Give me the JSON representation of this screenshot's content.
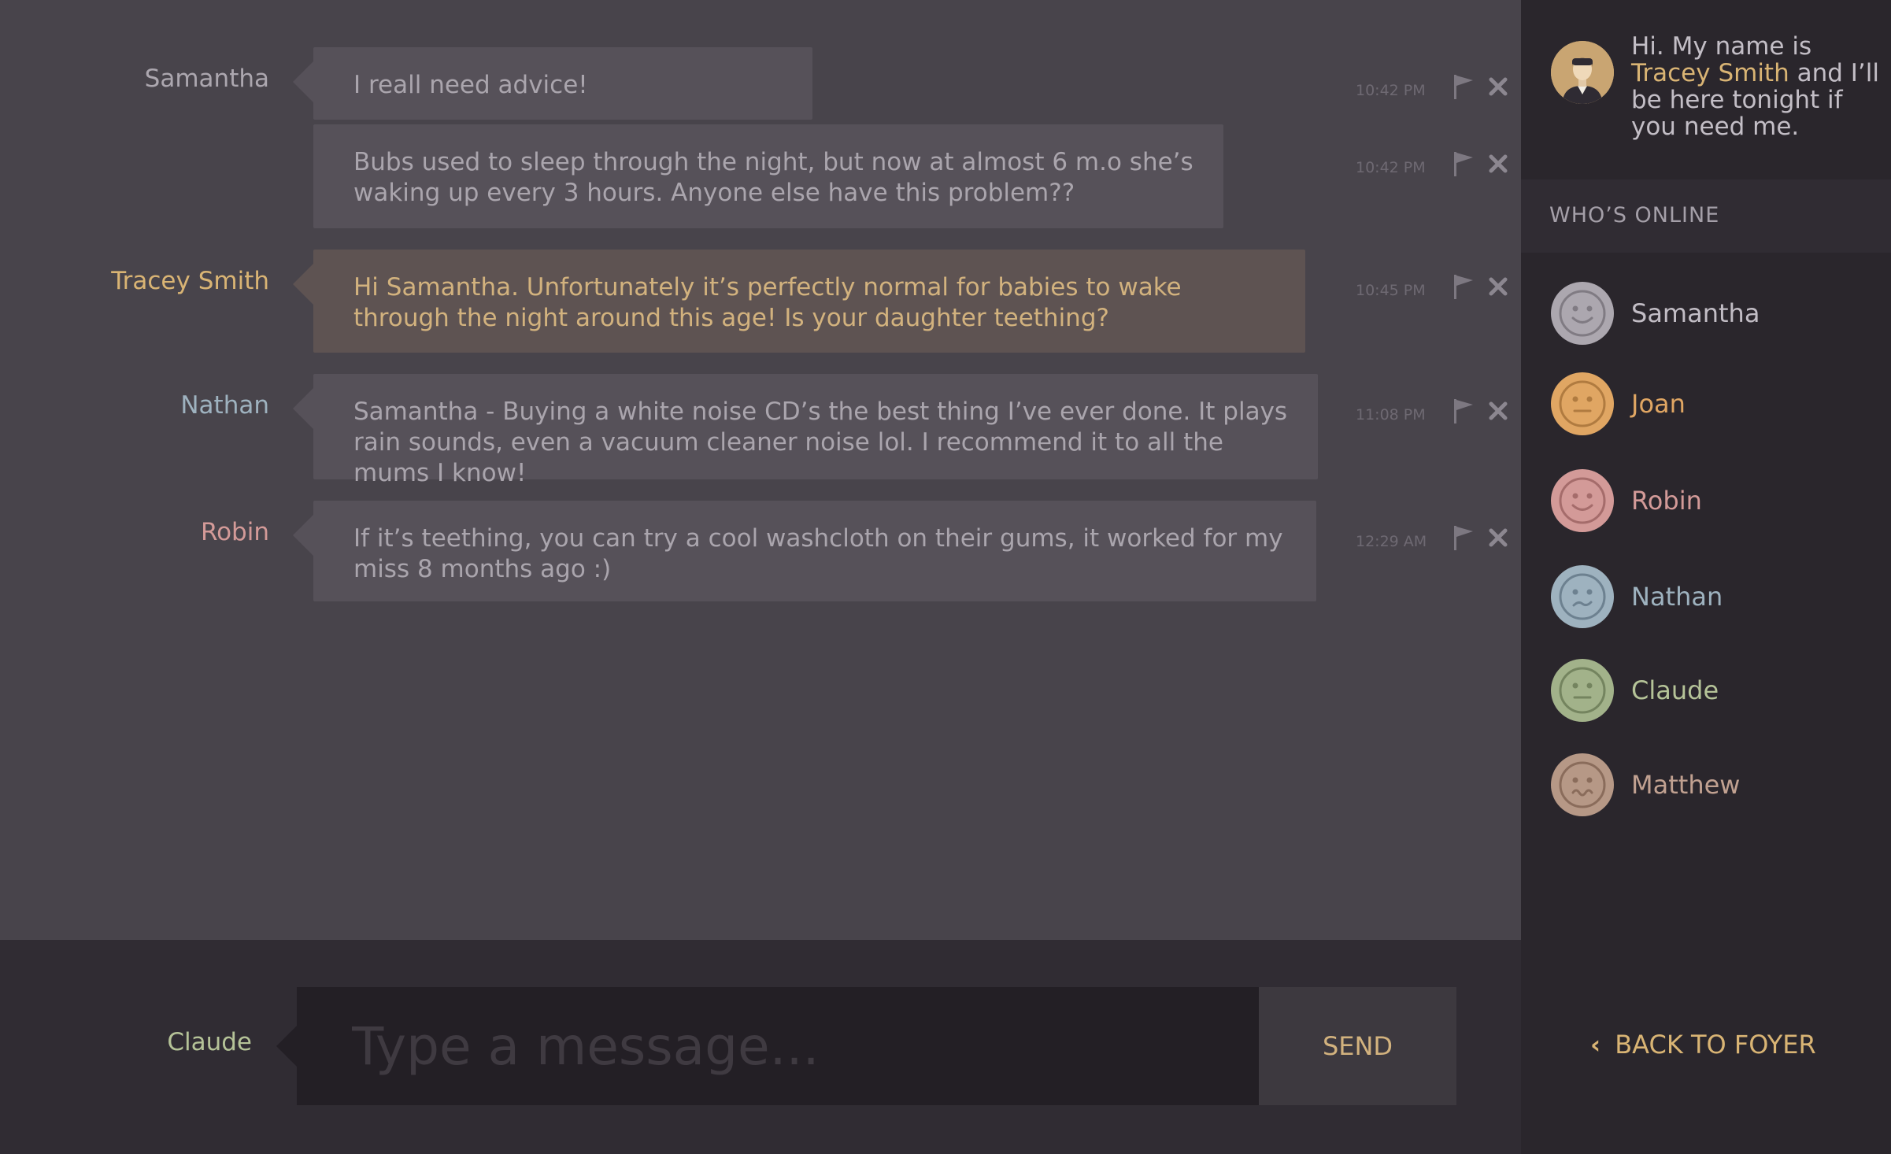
{
  "colors": {
    "samantha": "#aca7af",
    "tracey": "#d9b474",
    "nathan": "#9eb2bf",
    "robin": "#d39a98",
    "claude": "#b5c398",
    "joan": "#e0a663",
    "matthew": "#c1a191"
  },
  "messages": [
    {
      "sender": "Samantha",
      "text": "I reall need advice!",
      "time": "10:42 PM"
    },
    {
      "sender": "",
      "text": "Bubs used to sleep through the night, but now at almost 6 m.o she’s waking up every 3 hours. Anyone else have this problem??",
      "time": "10:42 PM"
    },
    {
      "sender": "Tracey Smith",
      "text": "Hi Samantha. Unfortunately it’s perfectly normal for babies to wake through the night around this age! Is your daughter teething?",
      "time": "10:45 PM"
    },
    {
      "sender": "Nathan",
      "text": "Samantha - Buying a white noise CD’s the best thing I’ve ever done. It plays rain sounds, even a vacuum cleaner noise lol. I recommend it to all the mums I know!",
      "time": "11:08 PM"
    },
    {
      "sender": "Robin",
      "text": "If it’s teething, you can try a cool washcloth on their gums, it worked for my miss 8 months ago :)",
      "time": "12:29 AM"
    }
  ],
  "host": {
    "intro_prefix": "Hi. My name is ",
    "name": "Tracey Smith",
    "intro_suffix": " and I’ll be here tonight if you need me."
  },
  "online": {
    "title": "WHO’S ONLINE",
    "users": [
      {
        "name": "Samantha",
        "icon": "smile-face-icon"
      },
      {
        "name": "Joan",
        "icon": "neutral-face-icon"
      },
      {
        "name": "Robin",
        "icon": "smile-face-icon"
      },
      {
        "name": "Nathan",
        "icon": "worried-face-icon"
      },
      {
        "name": "Claude",
        "icon": "neutral-face-icon"
      },
      {
        "name": "Matthew",
        "icon": "wavy-mouth-face-icon"
      }
    ]
  },
  "composer": {
    "user": "Claude",
    "placeholder": "Type a message...",
    "send_label": "SEND"
  },
  "footer": {
    "back_label": "BACK TO FOYER"
  }
}
